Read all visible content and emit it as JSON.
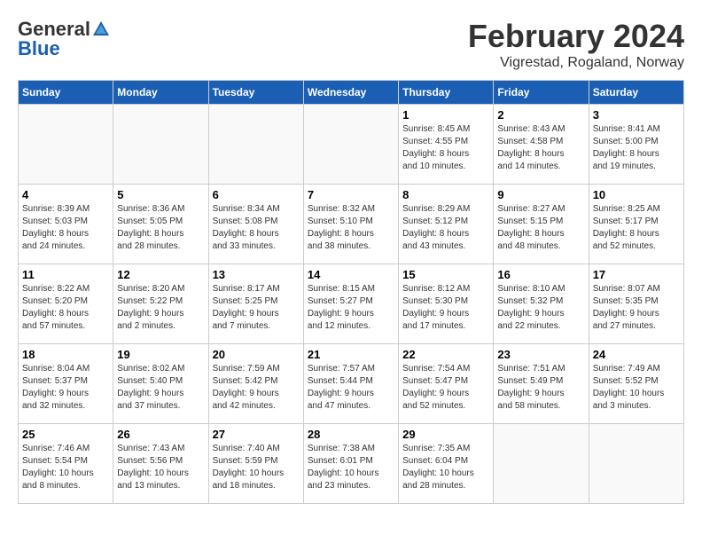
{
  "header": {
    "logo_general": "General",
    "logo_blue": "Blue",
    "month_title": "February 2024",
    "subtitle": "Vigrestad, Rogaland, Norway"
  },
  "days_of_week": [
    "Sunday",
    "Monday",
    "Tuesday",
    "Wednesday",
    "Thursday",
    "Friday",
    "Saturday"
  ],
  "weeks": [
    [
      {
        "day": "",
        "info": ""
      },
      {
        "day": "",
        "info": ""
      },
      {
        "day": "",
        "info": ""
      },
      {
        "day": "",
        "info": ""
      },
      {
        "day": "1",
        "info": "Sunrise: 8:45 AM\nSunset: 4:55 PM\nDaylight: 8 hours\nand 10 minutes."
      },
      {
        "day": "2",
        "info": "Sunrise: 8:43 AM\nSunset: 4:58 PM\nDaylight: 8 hours\nand 14 minutes."
      },
      {
        "day": "3",
        "info": "Sunrise: 8:41 AM\nSunset: 5:00 PM\nDaylight: 8 hours\nand 19 minutes."
      }
    ],
    [
      {
        "day": "4",
        "info": "Sunrise: 8:39 AM\nSunset: 5:03 PM\nDaylight: 8 hours\nand 24 minutes."
      },
      {
        "day": "5",
        "info": "Sunrise: 8:36 AM\nSunset: 5:05 PM\nDaylight: 8 hours\nand 28 minutes."
      },
      {
        "day": "6",
        "info": "Sunrise: 8:34 AM\nSunset: 5:08 PM\nDaylight: 8 hours\nand 33 minutes."
      },
      {
        "day": "7",
        "info": "Sunrise: 8:32 AM\nSunset: 5:10 PM\nDaylight: 8 hours\nand 38 minutes."
      },
      {
        "day": "8",
        "info": "Sunrise: 8:29 AM\nSunset: 5:12 PM\nDaylight: 8 hours\nand 43 minutes."
      },
      {
        "day": "9",
        "info": "Sunrise: 8:27 AM\nSunset: 5:15 PM\nDaylight: 8 hours\nand 48 minutes."
      },
      {
        "day": "10",
        "info": "Sunrise: 8:25 AM\nSunset: 5:17 PM\nDaylight: 8 hours\nand 52 minutes."
      }
    ],
    [
      {
        "day": "11",
        "info": "Sunrise: 8:22 AM\nSunset: 5:20 PM\nDaylight: 8 hours\nand 57 minutes."
      },
      {
        "day": "12",
        "info": "Sunrise: 8:20 AM\nSunset: 5:22 PM\nDaylight: 9 hours\nand 2 minutes."
      },
      {
        "day": "13",
        "info": "Sunrise: 8:17 AM\nSunset: 5:25 PM\nDaylight: 9 hours\nand 7 minutes."
      },
      {
        "day": "14",
        "info": "Sunrise: 8:15 AM\nSunset: 5:27 PM\nDaylight: 9 hours\nand 12 minutes."
      },
      {
        "day": "15",
        "info": "Sunrise: 8:12 AM\nSunset: 5:30 PM\nDaylight: 9 hours\nand 17 minutes."
      },
      {
        "day": "16",
        "info": "Sunrise: 8:10 AM\nSunset: 5:32 PM\nDaylight: 9 hours\nand 22 minutes."
      },
      {
        "day": "17",
        "info": "Sunrise: 8:07 AM\nSunset: 5:35 PM\nDaylight: 9 hours\nand 27 minutes."
      }
    ],
    [
      {
        "day": "18",
        "info": "Sunrise: 8:04 AM\nSunset: 5:37 PM\nDaylight: 9 hours\nand 32 minutes."
      },
      {
        "day": "19",
        "info": "Sunrise: 8:02 AM\nSunset: 5:40 PM\nDaylight: 9 hours\nand 37 minutes."
      },
      {
        "day": "20",
        "info": "Sunrise: 7:59 AM\nSunset: 5:42 PM\nDaylight: 9 hours\nand 42 minutes."
      },
      {
        "day": "21",
        "info": "Sunrise: 7:57 AM\nSunset: 5:44 PM\nDaylight: 9 hours\nand 47 minutes."
      },
      {
        "day": "22",
        "info": "Sunrise: 7:54 AM\nSunset: 5:47 PM\nDaylight: 9 hours\nand 52 minutes."
      },
      {
        "day": "23",
        "info": "Sunrise: 7:51 AM\nSunset: 5:49 PM\nDaylight: 9 hours\nand 58 minutes."
      },
      {
        "day": "24",
        "info": "Sunrise: 7:49 AM\nSunset: 5:52 PM\nDaylight: 10 hours\nand 3 minutes."
      }
    ],
    [
      {
        "day": "25",
        "info": "Sunrise: 7:46 AM\nSunset: 5:54 PM\nDaylight: 10 hours\nand 8 minutes."
      },
      {
        "day": "26",
        "info": "Sunrise: 7:43 AM\nSunset: 5:56 PM\nDaylight: 10 hours\nand 13 minutes."
      },
      {
        "day": "27",
        "info": "Sunrise: 7:40 AM\nSunset: 5:59 PM\nDaylight: 10 hours\nand 18 minutes."
      },
      {
        "day": "28",
        "info": "Sunrise: 7:38 AM\nSunset: 6:01 PM\nDaylight: 10 hours\nand 23 minutes."
      },
      {
        "day": "29",
        "info": "Sunrise: 7:35 AM\nSunset: 6:04 PM\nDaylight: 10 hours\nand 28 minutes."
      },
      {
        "day": "",
        "info": ""
      },
      {
        "day": "",
        "info": ""
      }
    ]
  ]
}
